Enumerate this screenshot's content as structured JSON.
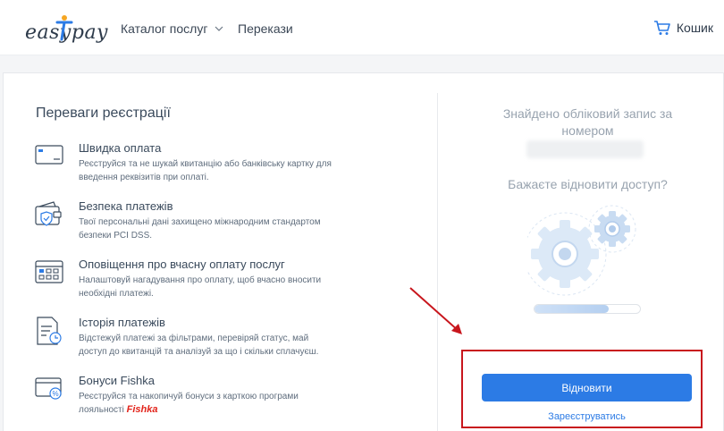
{
  "header": {
    "logo_text": "easypay",
    "nav": {
      "catalog_label": "Каталог послуг",
      "transfers_label": "Перекази"
    },
    "cart_label": "Кошик"
  },
  "left": {
    "title": "Переваги реєстрації",
    "benefits": [
      {
        "title": "Швидка оплата",
        "desc": "Реєструйся та не шукай квитанцію або банківську картку для введення реквізитів при оплаті.",
        "icon": "card-icon"
      },
      {
        "title": "Безпека платежів",
        "desc": "Твої персональні дані захищено міжнародним стандартом безпеки PCI DSS.",
        "icon": "wallet-shield-icon"
      },
      {
        "title": "Оповіщення про вчасну оплату послуг",
        "desc": "Налаштовуй нагадування про оплату, щоб вчасно вносити необхідні платежі.",
        "icon": "calendar-icon"
      },
      {
        "title": "Історія платежів",
        "desc": "Відстежуй платежі за фільтрами, перевіряй статус, май доступ до квитанцій та аналізуй за що і скільки сплачуєш.",
        "icon": "history-document-icon"
      },
      {
        "title": "Бонуси Fishka",
        "desc": "Реєструйся та накопичуй бонуси з карткою програми лояльності",
        "brand": "Fishka",
        "icon": "bonus-card-icon"
      }
    ]
  },
  "right": {
    "found_text": "Знайдено обліковий запис за номером",
    "restore_question": "Бажаєте відновити доступ?",
    "progress": 0.7,
    "restore_button": "Відновити",
    "register_link": "Зареєструватись"
  },
  "colors": {
    "accent": "#2c7be5",
    "highlight": "#c8161d",
    "fishka": "#e2231a"
  }
}
